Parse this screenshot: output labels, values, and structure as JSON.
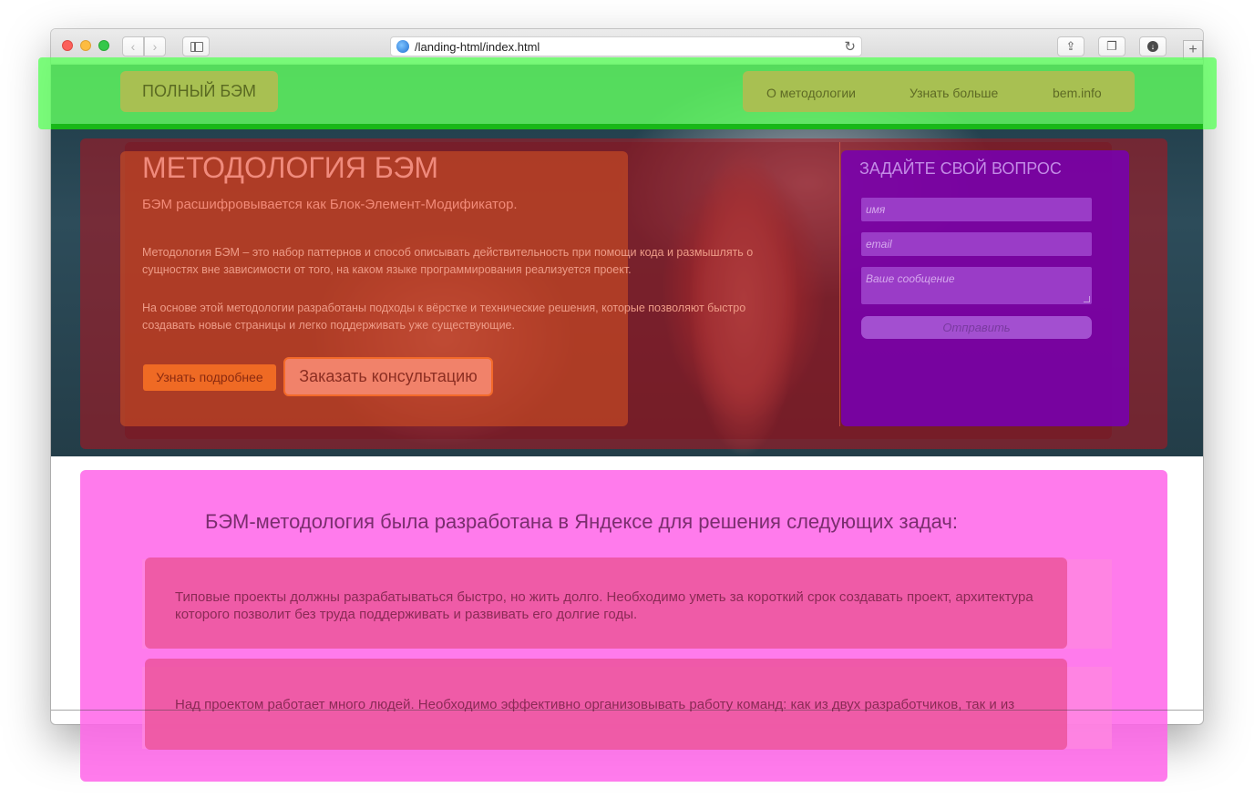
{
  "browser": {
    "url": "/landing-html/index.html"
  },
  "header": {
    "logo": "ПОЛНЫЙ БЭМ",
    "nav": [
      "О методологии",
      "Узнать больше",
      "bem.info"
    ]
  },
  "hero": {
    "title": "МЕТОДОЛОГИЯ БЭМ",
    "subtitle": "БЭМ расшифровывается как Блок-Элемент-Модификатор.",
    "paragraph1": "Методология БЭМ – это набор паттернов и способ описывать действительность при помощи кода и размышлять о сущностях вне зависимости от того, на каком языке программирования реализуется проект.",
    "paragraph2": "На основе этой методологии разработаны подходы к вёрстке и технические решения, которые позволяют быстро создавать новые страницы и легко поддерживать уже существующие.",
    "btn_more": "Узнать подробнее",
    "btn_consult": "Заказать консультацию"
  },
  "form": {
    "title": "ЗАДАЙТЕ СВОЙ ВОПРОС",
    "name_placeholder": "имя",
    "email_placeholder": "email",
    "message_placeholder": "Ваше сообщение",
    "submit": "Отправить"
  },
  "tasks": {
    "heading": "БЭМ-методология была разработана в Яндексе для решения следующих задач:",
    "items": [
      "Типовые проекты должны разрабатываться быстро, но жить долго. Необходимо уметь за короткий срок создавать проект, архитектура которого позволит без труда поддерживать и развивать его долгие годы.",
      "Над проектом работает много людей. Необходимо эффективно организовывать работу команд: как из двух разработчиков, так и из"
    ]
  },
  "colors": {
    "header_overlay": "#62ff62",
    "hero_overlay": "#b2121e",
    "form_overlay": "#7800af",
    "section_overlay": "#ff64e9",
    "accent_button": "#ef6a24"
  }
}
